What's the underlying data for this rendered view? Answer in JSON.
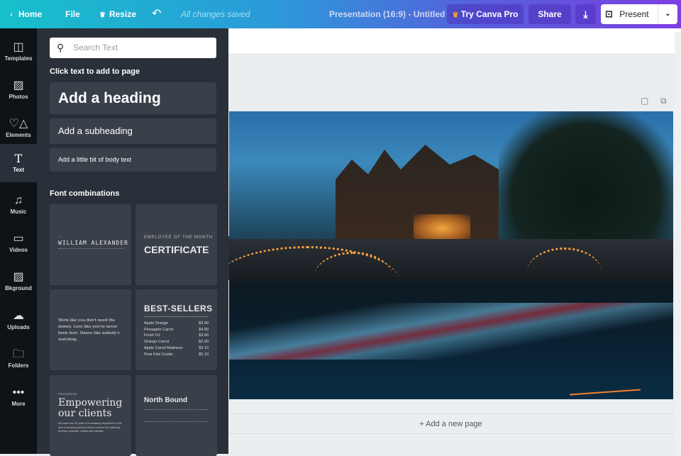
{
  "header": {
    "home": "Home",
    "file": "File",
    "resize": "Resize",
    "status": "All changes saved",
    "title": "Presentation (16:9) - Untitled",
    "try_pro": "Try Canva Pro",
    "share": "Share",
    "present": "Present"
  },
  "sidebar": {
    "items": [
      {
        "label": "Templates",
        "icon": "templates-icon"
      },
      {
        "label": "Photos",
        "icon": "photo-icon"
      },
      {
        "label": "Elements",
        "icon": "shapes-icon"
      },
      {
        "label": "Text",
        "icon": "text-icon"
      },
      {
        "label": "Music",
        "icon": "music-icon"
      },
      {
        "label": "Videos",
        "icon": "video-icon"
      },
      {
        "label": "Bkground",
        "icon": "background-icon"
      },
      {
        "label": "Uploads",
        "icon": "upload-cloud-icon"
      },
      {
        "label": "Folders",
        "icon": "folder-icon"
      },
      {
        "label": "More",
        "icon": "more-icon"
      }
    ],
    "active": "Text"
  },
  "panel": {
    "search_placeholder": "Search Text",
    "click_hint": "Click text to add to page",
    "heading": "Add a heading",
    "subheading": "Add a subheading",
    "body": "Add a little bit of body text",
    "font_combinations": "Font combinations",
    "cards": {
      "william": {
        "name": "WILLIAM ALEXANDER"
      },
      "certificate": {
        "kicker": "EMPLOYEE OF THE MONTH",
        "title": "CERTIFICATE"
      },
      "quote": {
        "text": "Work like you don't need the money. Love like you've never been hurt. Dance like nobody's watching."
      },
      "bestsellers": {
        "title": "BEST-SELLERS",
        "items": [
          [
            "Apple Orange",
            "$3.90"
          ],
          [
            "Pineapple Carrot",
            "$4.90"
          ],
          [
            "Fresh OJ",
            "$3.90"
          ],
          [
            "Orange Carrot",
            "$2.90"
          ],
          [
            "Apple Carrot Madness",
            "$3.10"
          ],
          [
            "Pear Kiwi Cooler",
            "$5.10"
          ]
        ]
      },
      "empowering": {
        "kicker": "PROGRESS",
        "title": "Empowering our clients",
        "body": "We have over 20 years of consultancy experience in this area of business and we strive to achieve the following: develop, empower, enable and maintain."
      },
      "northbound": {
        "title": "North Bound"
      }
    }
  },
  "canvas": {
    "add_page": "+ Add a new page"
  },
  "colors": {
    "header_start": "#17c0cb",
    "header_end": "#7c3fe0",
    "sidebar": "#0e1318",
    "panel": "#293039"
  }
}
